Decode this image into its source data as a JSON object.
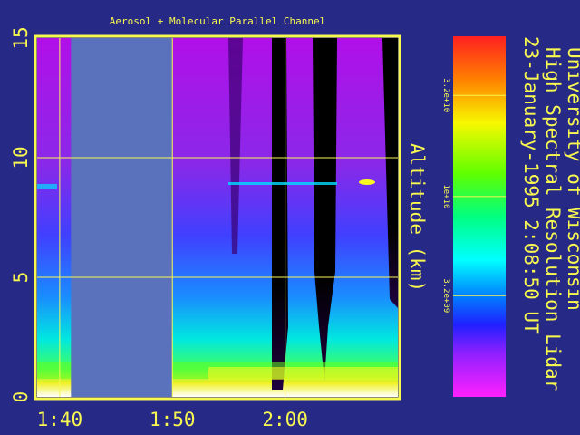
{
  "chart_data": {
    "type": "heatmap",
    "title": "Aerosol + Molecular Parallel Channel",
    "ylabel": "Altitude (km)",
    "xlabel": "",
    "x_ticks": [
      "1:40",
      "1:50",
      "2:00"
    ],
    "y_ticks": [
      "0",
      "5",
      "10",
      "15"
    ],
    "xlim": [
      "1:38",
      "1:70"
    ],
    "ylim": [
      0,
      15
    ],
    "grid": true,
    "no_data_interval": [
      "1:41",
      "1:50"
    ],
    "colorbar": {
      "scale": "log",
      "ticks": [
        "3.2e+10",
        "1e+10",
        "3.2e+09"
      ],
      "colors": [
        "#ff2020",
        "#ff8000",
        "#f8f800",
        "#60ff00",
        "#00ff80",
        "#00ffff",
        "#0080ff",
        "#2020ff",
        "#9020ff",
        "#ff20ff"
      ]
    },
    "info_lines": [
      "University of Wisconsin",
      "High Spectral Resolution Lidar",
      "23-January-1995   2:08:50 UT"
    ]
  },
  "colors": {
    "background": "#262a86",
    "frame": "#f8f850",
    "grid": "#f8f850",
    "nodata": "#5a72bc"
  }
}
